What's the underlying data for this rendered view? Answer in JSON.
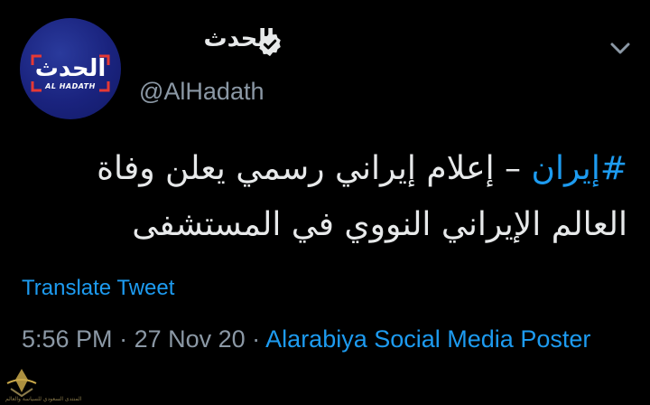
{
  "account": {
    "display_name": "الحدث",
    "handle": "@AlHadath",
    "avatar_brand": "الحدث",
    "avatar_subtitle": "AL HADATH",
    "verified": true,
    "verified_icon": "verified-badge-icon",
    "menu_icon": "chevron-down-icon"
  },
  "tweet": {
    "hashtag": "#إيران",
    "body": " – إعلام إيراني رسمي يعلن وفاة العالم الإيراني النووي في المستشفى",
    "translate_label": "Translate Tweet",
    "time": "5:56 PM",
    "date": "27 Nov 20",
    "separator": " · ",
    "source": "Alarabiya Social Media Poster"
  },
  "watermark": {
    "text": "المنتدى السعودي للسياسة والعالم"
  },
  "colors": {
    "background": "#000000",
    "text": "#e7e9ea",
    "muted": "#8b98a5",
    "link": "#1d9bf0",
    "avatar_blue": "#1a237e",
    "avatar_red": "#e53935"
  }
}
